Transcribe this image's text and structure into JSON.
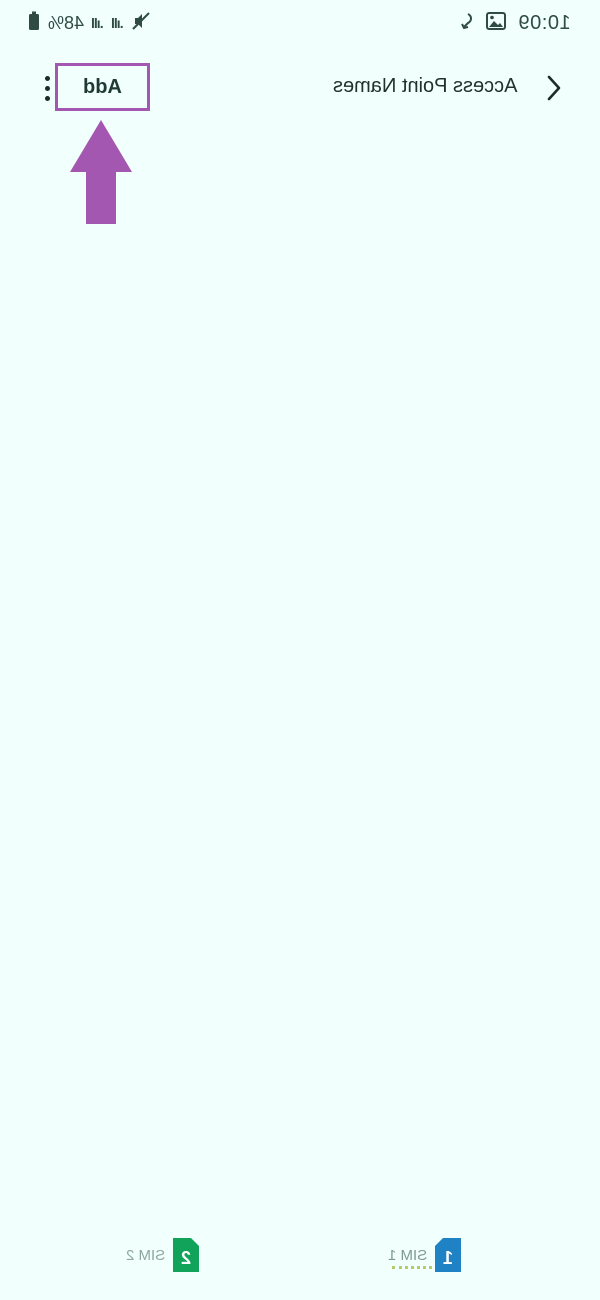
{
  "status_bar": {
    "time": "10:09",
    "battery": "48%",
    "icons": [
      "sync-icon",
      "image-icon",
      "battery-icon",
      "signal-icon",
      "signal-icon",
      "no-sound-icon"
    ]
  },
  "header": {
    "title": "Access Point Names",
    "add_label": "Add",
    "back_icon": "chevron-left-icon",
    "more_icon": "more-vert-icon"
  },
  "annotation": {
    "highlight_color": "#a457b0",
    "arrow_color": "#a457b0"
  },
  "sim_tabs": [
    {
      "label": "SIM 1",
      "number": "1",
      "color": "#1f82c4",
      "selected": true
    },
    {
      "label": "SIM 2",
      "number": "2",
      "color": "#12a35a",
      "selected": false
    }
  ]
}
